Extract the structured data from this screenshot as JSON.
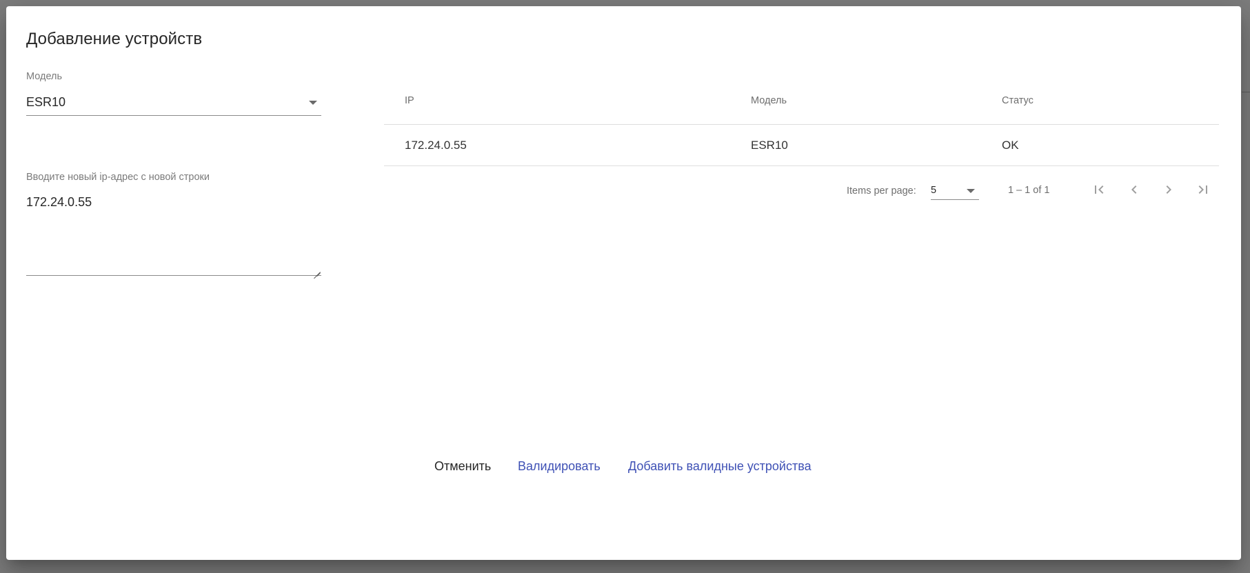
{
  "dialog": {
    "title": "Добавление устройств"
  },
  "model_field": {
    "label": "Модель",
    "value": "ESR10"
  },
  "ip_field": {
    "label": "Вводите новый ip-адрес с новой строки",
    "value": "172.24.0.55"
  },
  "table": {
    "columns": [
      "IP",
      "Модель",
      "Статус"
    ],
    "rows": [
      [
        "172.24.0.55",
        "ESR10",
        "OK"
      ]
    ]
  },
  "paginator": {
    "items_per_page_label": "Items per page:",
    "items_per_page_value": "5",
    "range_label": "1 – 1 of 1"
  },
  "actions": {
    "cancel": "Отменить",
    "validate": "Валидировать",
    "add_valid": "Добавить валидные устройства"
  },
  "colors": {
    "primary": "#3f51b5",
    "text": "#262626",
    "muted": "#6e6e6e",
    "icon_disabled": "#9e9e9e"
  },
  "icons": {
    "first_page": "first-page-icon",
    "prev_page": "chevron-left-icon",
    "next_page": "chevron-right-icon",
    "last_page": "last-page-icon",
    "dropdown": "arrow-drop-down-icon"
  }
}
